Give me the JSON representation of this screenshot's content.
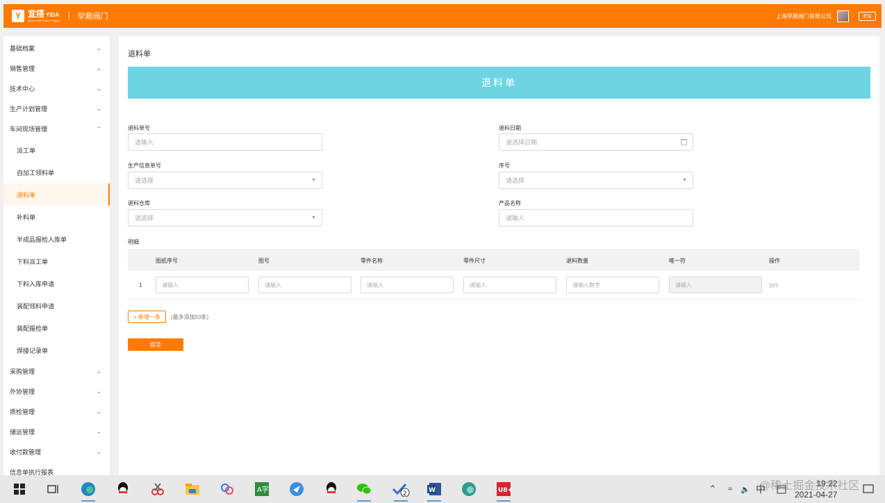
{
  "header": {
    "logo_cn": "宜搭",
    "logo_en": "YIDA",
    "logo_tagline": "Make Work Easy & Happy",
    "app_name": "罕鼎阀门",
    "company": "上海罕鼎阀门有限公司",
    "lang_button": "EN",
    "accent": "#ff7a00"
  },
  "sidebar": {
    "menus_top": [
      {
        "label": "基础档案"
      },
      {
        "label": "销售管理"
      },
      {
        "label": "技术中心"
      },
      {
        "label": "生产计划管理"
      }
    ],
    "open_menu": {
      "label": "车间现场管理"
    },
    "sub_items": [
      {
        "label": "派工单"
      },
      {
        "label": "自加工领料单"
      },
      {
        "label": "退料单",
        "active": true
      },
      {
        "label": "补料单"
      },
      {
        "label": "半成品报检入库单"
      },
      {
        "label": "下料派工单"
      },
      {
        "label": "下料入库申请"
      },
      {
        "label": "装配领料申请"
      },
      {
        "label": "装配报检单"
      },
      {
        "label": "焊接记录单"
      }
    ],
    "menus_bottom": [
      {
        "label": "采购管理"
      },
      {
        "label": "外协管理"
      },
      {
        "label": "质检管理"
      },
      {
        "label": "储运管理"
      },
      {
        "label": "收付款管理"
      },
      {
        "label": "信息单执行报表"
      }
    ]
  },
  "main": {
    "page_title": "退料单",
    "banner_title": "退料单",
    "banner_color": "#6dd5e2",
    "fields": {
      "return_no": {
        "label": "退料单号",
        "placeholder": "请输入"
      },
      "return_date": {
        "label": "退料日期",
        "placeholder": "请选择日期"
      },
      "production_no": {
        "label": "生产信息单号",
        "placeholder": "请选择"
      },
      "seq_no": {
        "label": "序号",
        "placeholder": "请选择"
      },
      "warehouse": {
        "label": "退料仓库",
        "placeholder": "请选择"
      },
      "product_name": {
        "label": "产品名称",
        "placeholder": "请输入"
      }
    },
    "detail_label": "明细",
    "table": {
      "headers": [
        "图纸序号",
        "图号",
        "零件名称",
        "零件尺寸",
        "退料数量",
        "唯一符",
        "操作"
      ],
      "row": {
        "index": "1",
        "placeholders": [
          "请输入",
          "请输入",
          "请输入",
          "请输入",
          "请输入数字",
          "请输入"
        ],
        "delete_label": "删除"
      }
    },
    "add_button": "+ 新增一条",
    "add_note": "(最多添加50条)",
    "submit_button": "提交"
  },
  "taskbar": {
    "time": "19:22",
    "date": "2021-04-27",
    "ime": "中",
    "badge": "2",
    "watermark": "@稀土掘金技术社区"
  }
}
